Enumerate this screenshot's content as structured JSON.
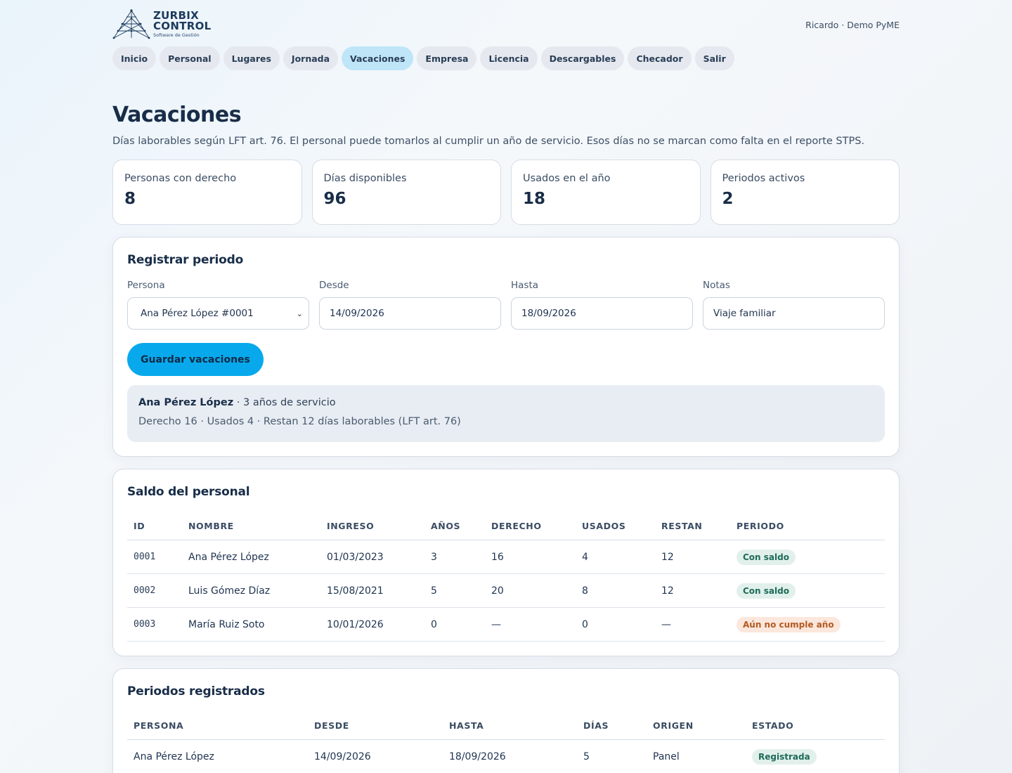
{
  "brand": {
    "line1": "ZURBIX",
    "line2": "CONTROL",
    "tagline": "Software de Gestión"
  },
  "user": "Ricardo · Demo PyME",
  "nav": [
    {
      "label": "Inicio",
      "active": false
    },
    {
      "label": "Personal",
      "active": false
    },
    {
      "label": "Lugares",
      "active": false
    },
    {
      "label": "Jornada",
      "active": false
    },
    {
      "label": "Vacaciones",
      "active": true
    },
    {
      "label": "Empresa",
      "active": false
    },
    {
      "label": "Licencia",
      "active": false
    },
    {
      "label": "Descargables",
      "active": false
    },
    {
      "label": "Checador",
      "active": false
    },
    {
      "label": "Salir",
      "active": false
    }
  ],
  "page": {
    "title": "Vacaciones",
    "subtitle": "Días laborables según LFT art. 76. El personal puede tomarlos al cumplir un año de servicio. Esos días no se marcan como falta en el reporte STPS."
  },
  "stats": [
    {
      "label": "Personas con derecho",
      "value": "8"
    },
    {
      "label": "Días disponibles",
      "value": "96"
    },
    {
      "label": "Usados en el año",
      "value": "18"
    },
    {
      "label": "Periodos activos",
      "value": "2"
    }
  ],
  "register": {
    "title": "Registrar periodo",
    "persona_label": "Persona",
    "persona_value": "Ana Pérez López #0001",
    "desde_label": "Desde",
    "desde_value": "14/09/2026",
    "hasta_label": "Hasta",
    "hasta_value": "18/09/2026",
    "notas_label": "Notas",
    "notas_value": "Viaje familiar",
    "save_label": "Guardar vacaciones",
    "info_name": "Ana Pérez López",
    "info_service": " · 3 años de servicio",
    "info_detail": "Derecho 16 · Usados 4 · Restan 12 días laborables (LFT art. 76)"
  },
  "saldo": {
    "title": "Saldo del personal",
    "headers": [
      "ID",
      "NOMBRE",
      "INGRESO",
      "AÑOS",
      "DERECHO",
      "USADOS",
      "RESTAN",
      "PERIODO"
    ],
    "rows": [
      {
        "id": "0001",
        "nombre": "Ana Pérez López",
        "ingreso": "01/03/2023",
        "anos": "3",
        "derecho": "16",
        "usados": "4",
        "restan": "12",
        "periodo": "Con saldo"
      },
      {
        "id": "0002",
        "nombre": "Luis Gómez Díaz",
        "ingreso": "15/08/2021",
        "anos": "5",
        "derecho": "20",
        "usados": "8",
        "restan": "12",
        "periodo": "Con saldo"
      },
      {
        "id": "0003",
        "nombre": "María Ruiz Soto",
        "ingreso": "10/01/2026",
        "anos": "0",
        "derecho": "—",
        "usados": "0",
        "restan": "—",
        "periodo": "Aún no cumple año"
      }
    ]
  },
  "periodos": {
    "title": "Periodos registrados",
    "headers": [
      "PERSONA",
      "DESDE",
      "HASTA",
      "DÍAS",
      "ORIGEN",
      "ESTADO"
    ],
    "rows": [
      {
        "persona": "Ana Pérez López",
        "desde": "14/09/2026",
        "hasta": "18/09/2026",
        "dias": "5",
        "origen": "Panel",
        "estado": "Registrada"
      }
    ]
  },
  "colors": {
    "accent": "#08a9ec",
    "active_nav": "#bfe6f8",
    "green_badge": "#e2f0ec",
    "orange_badge": "#fbe7dc"
  }
}
